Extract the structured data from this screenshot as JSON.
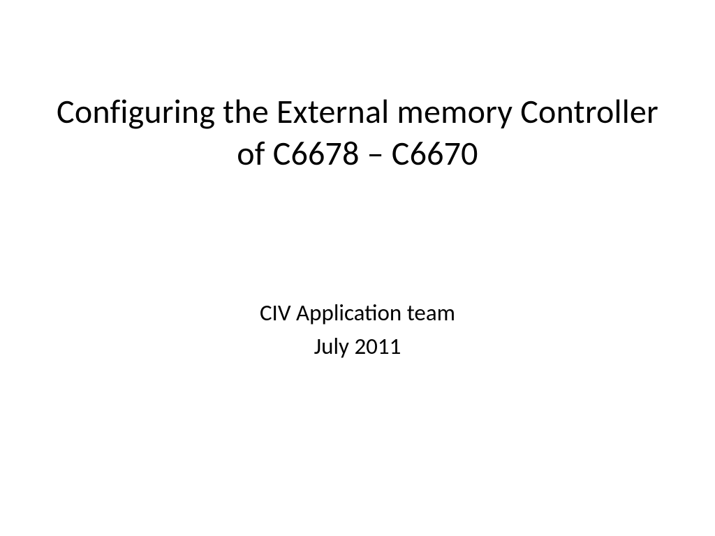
{
  "slide": {
    "title": "Configuring the External memory Controller of C6678 – C6670",
    "subtitle_line1": "CIV Application team",
    "subtitle_line2": "July 2011"
  }
}
